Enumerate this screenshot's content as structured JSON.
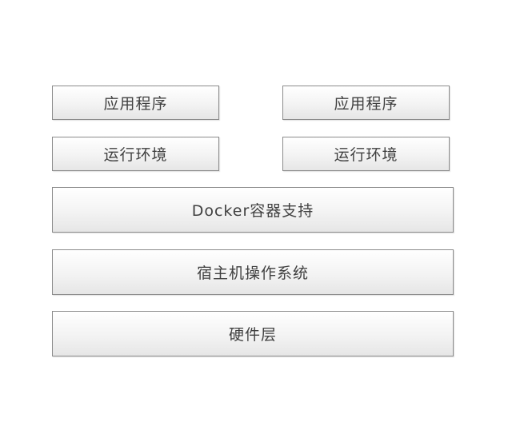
{
  "diagram": {
    "stacks": [
      {
        "application": "应用程序",
        "runtime": "运行环境"
      },
      {
        "application": "应用程序",
        "runtime": "运行环境"
      }
    ],
    "docker_layer": "Docker容器支持",
    "host_os_layer": "宿主机操作系统",
    "hardware_layer": "硬件层"
  }
}
